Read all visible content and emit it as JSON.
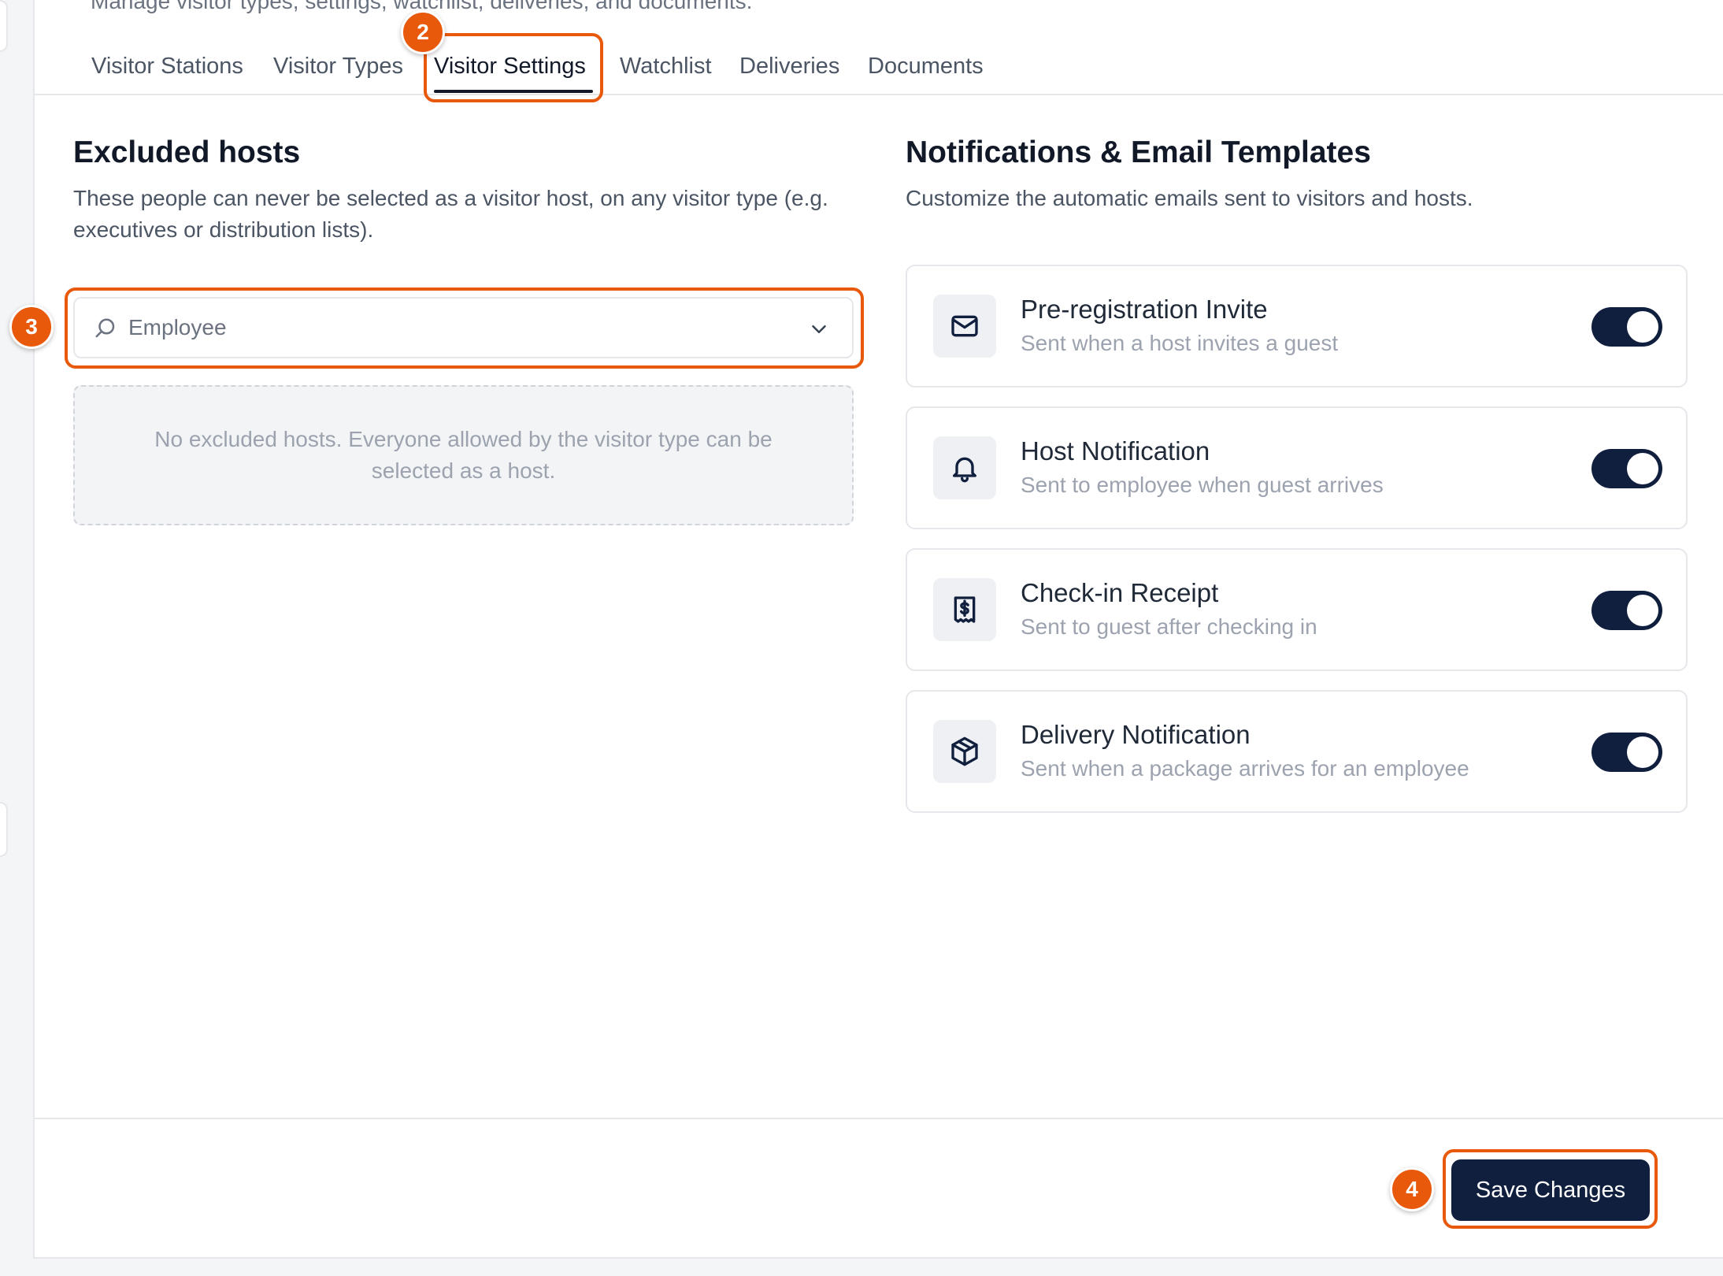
{
  "header": {
    "subtitle": "Manage visitor types, settings, watchlist, deliveries, and documents."
  },
  "tabs": [
    {
      "label": "Visitor Stations"
    },
    {
      "label": "Visitor Types"
    },
    {
      "label": "Visitor Settings",
      "active": true
    },
    {
      "label": "Watchlist"
    },
    {
      "label": "Deliveries"
    },
    {
      "label": "Documents"
    }
  ],
  "excluded_hosts": {
    "title": "Excluded hosts",
    "description": "These people can never be selected as a visitor host, on any visitor type (e.g. executives or distribution lists).",
    "search_placeholder": "Employee",
    "empty_message": "No excluded hosts. Everyone allowed by the visitor type can be selected as a host."
  },
  "notifications": {
    "title": "Notifications & Email Templates",
    "description": "Customize the automatic emails sent to visitors and hosts.",
    "items": [
      {
        "title": "Pre-registration Invite",
        "subtitle": "Sent when a host invites a guest",
        "icon": "mail-icon",
        "enabled": true
      },
      {
        "title": "Host Notification",
        "subtitle": "Sent to employee when guest arrives",
        "icon": "bell-icon",
        "enabled": true
      },
      {
        "title": "Check-in Receipt",
        "subtitle": "Sent to guest after checking in",
        "icon": "receipt-icon",
        "enabled": true
      },
      {
        "title": "Delivery Notification",
        "subtitle": "Sent when a package arrives for an employee",
        "icon": "package-icon",
        "enabled": true
      }
    ]
  },
  "footer": {
    "save_label": "Save Changes"
  },
  "annotations": {
    "step2": "2",
    "step3": "3",
    "step4": "4"
  },
  "colors": {
    "accent": "#e8590c",
    "primary_dark": "#0f1f3d",
    "muted_text": "#9ca3af"
  }
}
